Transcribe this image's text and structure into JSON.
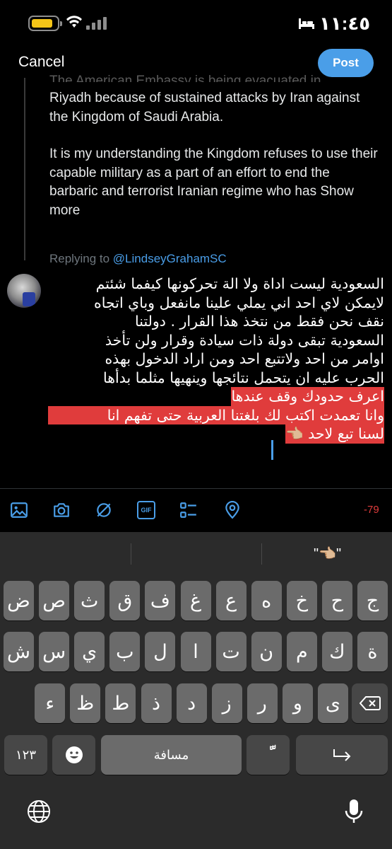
{
  "status": {
    "time": "١١:٤٥",
    "battery_level": 0.8,
    "accent_battery": "#f5c518"
  },
  "header": {
    "cancel_label": "Cancel",
    "post_label": "Post"
  },
  "quoted_tweet": {
    "hidden_top_line": "The American Embassy is being evacuated in",
    "paragraph1": "Riyadh because of sustained attacks by Iran against the Kingdom of Saudi Arabia.",
    "paragraph2": "It is my understanding the Kingdom refuses to use their capable military as a part of an effort to end the barbaric and terrorist Iranian regime who has",
    "show_more": "Show more"
  },
  "reply": {
    "replying_to": "Replying to",
    "handle": "@LindseyGrahamSC"
  },
  "compose": {
    "lines": [
      "السعودية ليست اداة ولا الة تحركونها كيفما شئتم",
      "لايمكن لاي احد اني يملي علينا مانفعل وباي اتجاه",
      "نقف نحن فقط من نتخذ هذا القرار . دولتنا",
      "السعودية تبقى دولة ذات سيادة وقرار ولن تأخذ",
      "اوامر من احد ولاتتبع احد ومن اراد الدخول بهذه",
      "الحرب عليه ان يتحمل نتائجها وينهيها مثلما بدأها"
    ],
    "selected_lines": [
      "اعرف حدودك وقف عندها",
      "وانا تعمدت اكتب لك بلغتنا العربية حتى تفهم انا",
      "لسنا تبع لاحد 👈🏼"
    ],
    "selection_color": "#e03c3c"
  },
  "toolbar": {
    "icons": [
      "image-icon",
      "camera-icon",
      "gif-scan-icon",
      "gif-icon",
      "poll-icon",
      "location-icon"
    ],
    "gif_label": "GIF",
    "char_counter": "-79",
    "accent": "#4a9ee8"
  },
  "keyboard": {
    "suggestion": "\"👈🏼\"",
    "row1": [
      "ج",
      "ح",
      "خ",
      "ه",
      "ع",
      "غ",
      "ف",
      "ق",
      "ث",
      "ص",
      "ض"
    ],
    "row2": [
      "ة",
      "ك",
      "م",
      "ن",
      "ت",
      "ا",
      "ل",
      "ب",
      "ي",
      "س",
      "ش"
    ],
    "row3": [
      "ى",
      "و",
      "ر",
      "ز",
      "د",
      "ذ",
      "ط",
      "ظ",
      "ء"
    ],
    "numbers_label": "١٢٣",
    "space_label": "مسافة",
    "diacritic_label": "ًّ"
  }
}
